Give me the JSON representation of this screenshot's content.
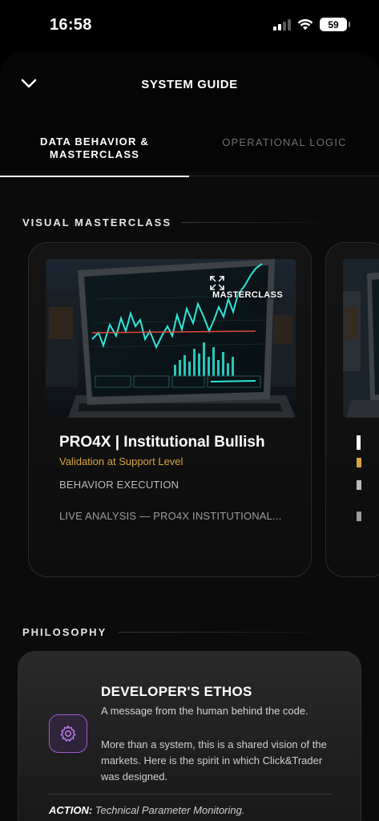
{
  "status": {
    "time": "16:58",
    "battery": "59"
  },
  "sheet": {
    "title": "SYSTEM GUIDE"
  },
  "tabs": [
    {
      "label_line1": "DATA BEHAVIOR &",
      "label_line2": "MASTERCLASS"
    },
    {
      "label": "OPERATIONAL LOGIC"
    }
  ],
  "sections": {
    "masterclass": "VISUAL MASTERCLASS",
    "philosophy": "PHILOSOPHY"
  },
  "card": {
    "badge": "MASTERCLASS",
    "title": "PRO4X | Institutional Bullish",
    "subtitle": "Validation at Support Level",
    "label": "BEHAVIOR EXECUTION",
    "description": "LIVE ANALYSIS — PRO4X INSTITUTIONAL..."
  },
  "ethos": {
    "title": "DEVELOPER'S ETHOS",
    "subtitle": "A message from the human behind the code.",
    "body": "More than a system, this is a shared vision of the markets. Here is the spirit in which Click&Trader was designed.",
    "action_key": "ACTION:",
    "action_value": "Technical Parameter Monitoring."
  },
  "colors": {
    "accent_gold": "#d9a441",
    "accent_purple": "#9b59d6",
    "chart_cyan": "#2ee6d6"
  }
}
